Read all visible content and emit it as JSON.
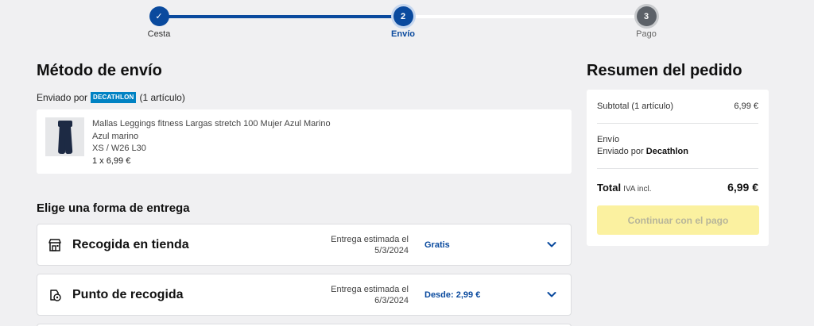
{
  "stepper": {
    "steps": [
      {
        "label": "Cesta",
        "marker": "✓",
        "state": "done"
      },
      {
        "label": "Envío",
        "marker": "2",
        "state": "active"
      },
      {
        "label": "Pago",
        "marker": "3",
        "state": "todo"
      }
    ]
  },
  "shipping": {
    "title": "Método de envío",
    "shipped_by_prefix": "Enviado por",
    "brand_badge": "DECATHLON",
    "item_count": "(1 artículo)",
    "product": {
      "name": "Mallas Leggings fitness Largas stretch 100 Mujer Azul Marino",
      "color": "Azul marino",
      "size": "XS / W26 L30",
      "qty_prefix": "1 x",
      "price": "6,99 €"
    }
  },
  "delivery": {
    "title": "Elige una forma de entrega",
    "options": [
      {
        "label": "Recogida en tienda",
        "date_label": "Entrega estimada el",
        "date": "5/3/2024",
        "price": "Gratis",
        "icon": "store-icon"
      },
      {
        "label": "Punto de recogida",
        "date_label": "Entrega estimada el",
        "date": "6/3/2024",
        "price": "Desde: 2,99 €",
        "icon": "pickup-point-icon"
      }
    ]
  },
  "summary": {
    "title": "Resumen del pedido",
    "subtotal_label": "Subtotal (1 artículo)",
    "subtotal_value": "6,99 €",
    "shipping_label": "Envío",
    "shipping_by_prefix": "Enviado por",
    "shipping_by": "Decathlon",
    "total_label": "Total",
    "total_tax": "IVA incl.",
    "total_value": "6,99 €",
    "button_label": "Continuar con el pago"
  },
  "colors": {
    "accent": "#0a4a9e",
    "brand": "#0082c3",
    "button_disabled_bg": "#fbf1a0",
    "background": "#f0f0f2"
  }
}
